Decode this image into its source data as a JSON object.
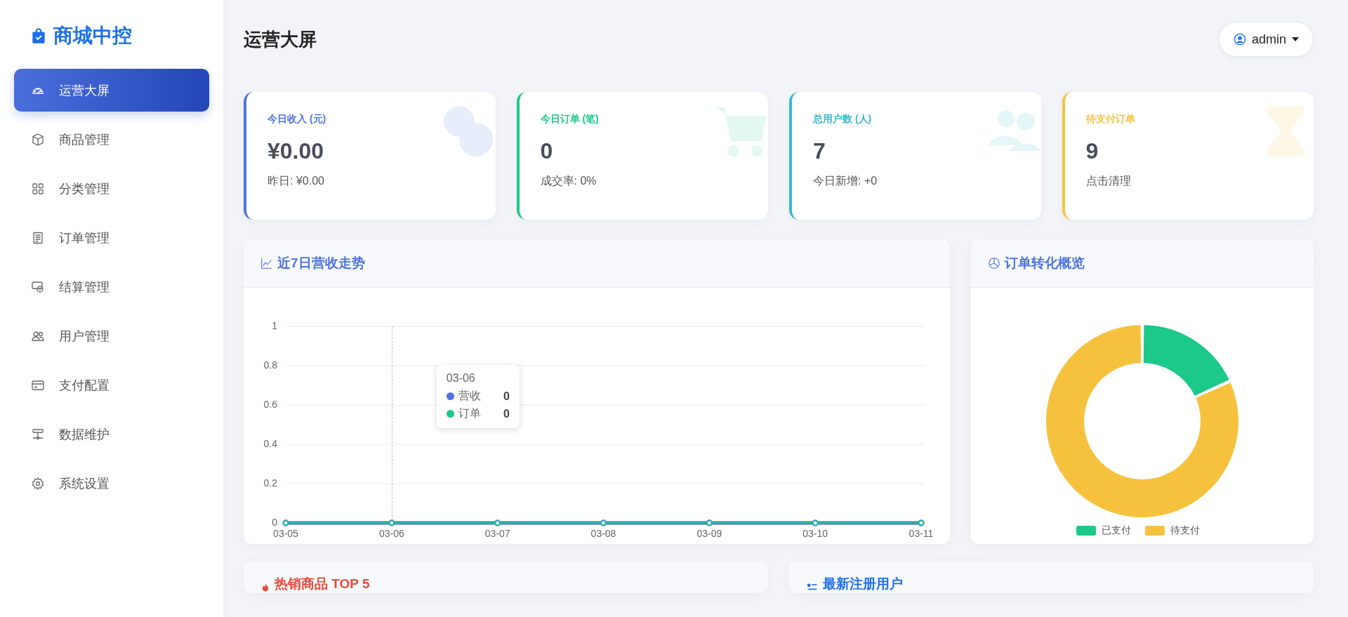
{
  "brand": {
    "name": "商城中控"
  },
  "sidebar": {
    "items": [
      {
        "label": "运营大屏",
        "selected": true
      },
      {
        "label": "商品管理",
        "selected": false
      },
      {
        "label": "分类管理",
        "selected": false
      },
      {
        "label": "订单管理",
        "selected": false
      },
      {
        "label": "结算管理",
        "selected": false
      },
      {
        "label": "用户管理",
        "selected": false
      },
      {
        "label": "支付配置",
        "selected": false
      },
      {
        "label": "数据维护",
        "selected": false
      },
      {
        "label": "系统设置",
        "selected": false
      }
    ]
  },
  "header": {
    "title": "运营大屏",
    "user_menu": {
      "label": "admin"
    }
  },
  "stat_cards": [
    {
      "title": "今日收入 (元)",
      "value": "¥0.00",
      "note": "昨日: ¥0.00",
      "color": "#4e73df"
    },
    {
      "title": "今日订单 (笔)",
      "value": "0",
      "note": "成交率: 0%",
      "color": "#1cc88a"
    },
    {
      "title": "总用户数 (人)",
      "value": "7",
      "note": "今日新增: +0",
      "color": "#36b9cc"
    },
    {
      "title": "待支付订单",
      "value": "9",
      "note": "点击清理",
      "color": "#f6c23e"
    }
  ],
  "revenue_panel": {
    "title": "近7日营收走势",
    "chart_data": {
      "type": "line",
      "categories": [
        "03-05",
        "03-06",
        "03-07",
        "03-08",
        "03-09",
        "03-10",
        "03-11"
      ],
      "ylim": [
        0,
        1
      ],
      "yticks": [
        0,
        0.2,
        0.4,
        0.6,
        0.8,
        1
      ],
      "grid": true,
      "series": [
        {
          "name": "营收",
          "color": "#4e73df",
          "marker": true,
          "values": [
            0,
            0,
            0,
            0,
            0,
            0,
            0
          ]
        },
        {
          "name": "订单",
          "color": "#1cc88a",
          "marker": true,
          "values": [
            0,
            0,
            0,
            0,
            0,
            0,
            0
          ]
        }
      ]
    },
    "tooltip": {
      "title": "03-06",
      "rows": [
        {
          "value": "0"
        },
        {
          "value": "0"
        }
      ]
    }
  },
  "conversion_panel": {
    "title": "订单转化概览",
    "legend": [
      {
        "label": "已支付",
        "color": "#1cc88a"
      },
      {
        "label": "待支付",
        "color": "#f6c23e"
      }
    ]
  },
  "bottom_panels": [
    {
      "title": "热销商品 TOP 5",
      "color": "#e74a3b"
    },
    {
      "title": "最新注册用户",
      "color": "#1a6fe8"
    }
  ]
}
